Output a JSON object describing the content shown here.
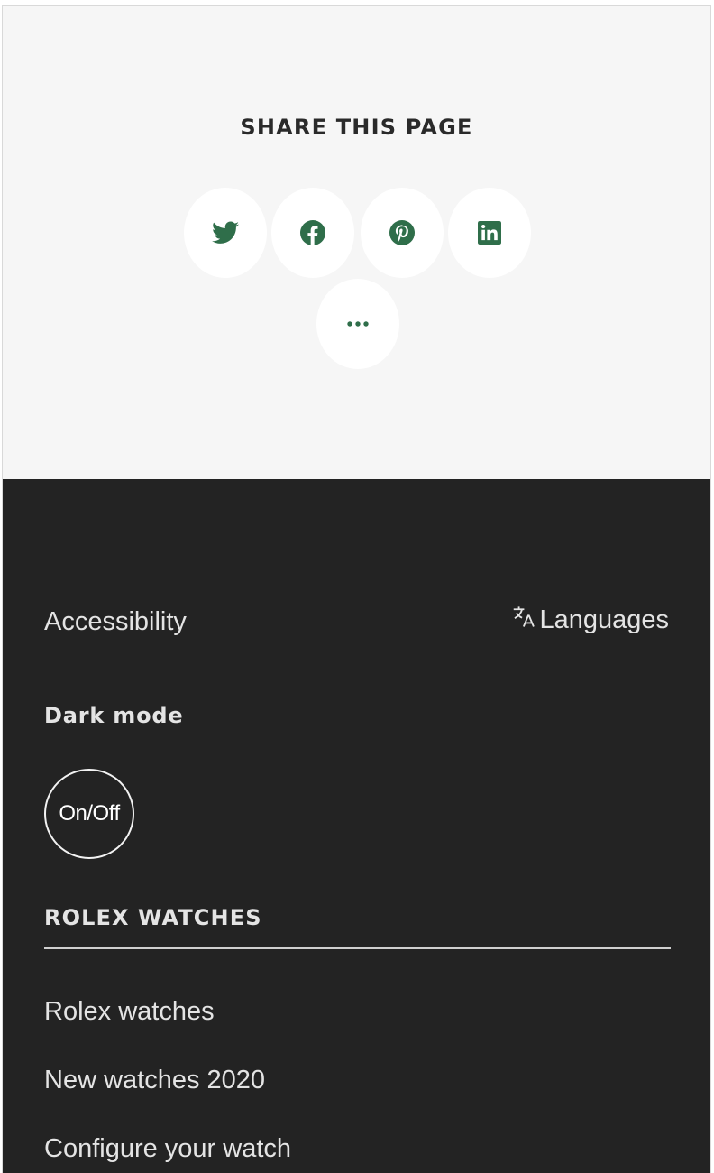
{
  "share": {
    "title": "SHARE THIS PAGE",
    "buttons": [
      {
        "name": "twitter",
        "icon": "twitter-icon"
      },
      {
        "name": "facebook",
        "icon": "facebook-icon"
      },
      {
        "name": "pinterest",
        "icon": "pinterest-icon"
      },
      {
        "name": "linkedin",
        "icon": "linkedin-icon"
      },
      {
        "name": "more",
        "icon": "more-dots-icon"
      }
    ],
    "icon_color": "#2f6e4a"
  },
  "footer": {
    "accessibility_label": "Accessibility",
    "languages_label": "Languages",
    "languages_icon": "translate-icon",
    "dark_mode_title": "Dark mode",
    "dark_mode_toggle": "On/Off",
    "section_title": "ROLEX WATCHES",
    "links": [
      "Rolex watches",
      "New watches 2020",
      "Configure your watch"
    ]
  },
  "colors": {
    "share_background": "#f6f6f6",
    "footer_background": "#232323",
    "footer_text": "#e4e4e4",
    "accent_green": "#2f6e4a"
  }
}
